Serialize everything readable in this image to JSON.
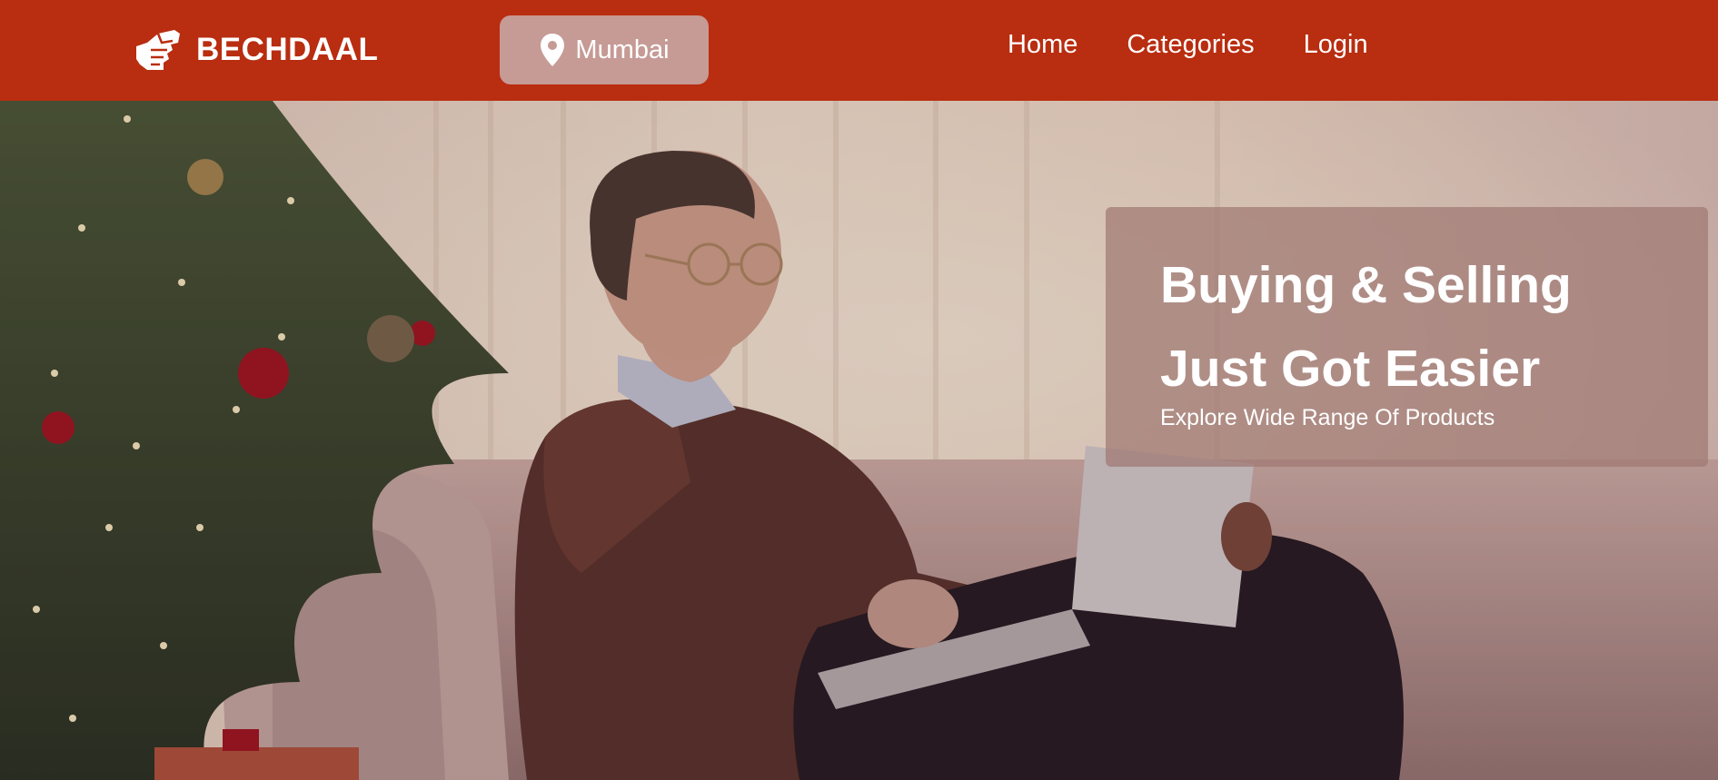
{
  "header": {
    "brand_name": "BECHDAAL",
    "brand_icon": "handshake-hand-icon",
    "location": {
      "icon": "map-pin-icon",
      "label": "Mumbai"
    },
    "nav": [
      {
        "label": "Home"
      },
      {
        "label": "Categories"
      },
      {
        "label": "Login"
      }
    ]
  },
  "hero": {
    "title_line1": "Buying & Selling",
    "title_line2": "Just Got Easier",
    "subtitle": "Explore Wide Range Of Products"
  },
  "colors": {
    "nav_background": "#b92d10",
    "text": "#ffffff",
    "location_button": "#c69a95",
    "hero_card": "rgba(160,120,115,0.72)"
  }
}
